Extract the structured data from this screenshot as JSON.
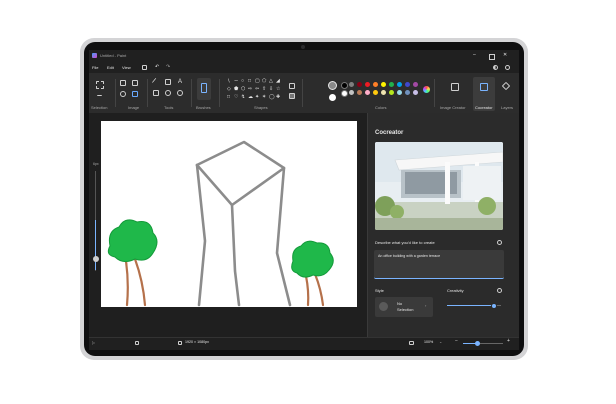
{
  "app": {
    "title": "Untitled - Paint"
  },
  "menu": {
    "file": "File",
    "edit": "Edit",
    "view": "View"
  },
  "ribbon": {
    "groups": {
      "selection": "Selection",
      "image": "Image",
      "tools": "Tools",
      "brushes": "Brushes",
      "shapes": "Shapes",
      "colors": "Colors",
      "image_creator": "Image Creator",
      "cocreator": "Cocreator",
      "layers": "Layers"
    },
    "palette": [
      "#000000",
      "#7f7f7f",
      "#880015",
      "#ed1c24",
      "#ff7f27",
      "#fff200",
      "#22b14c",
      "#00a2e8",
      "#3f48cc",
      "#a349a4",
      "#ffffff",
      "#c3c3c3",
      "#b97a57",
      "#ffaec9",
      "#ffc90e",
      "#efe4b0",
      "#b5e61d",
      "#99d9ea",
      "#7092be",
      "#c8bfe7"
    ]
  },
  "sidebar": {
    "brush_size_label": "6px",
    "brush_size_level": 0.45
  },
  "cocreator": {
    "title": "Cocreator",
    "describe_label": "Describe what you'd like to create",
    "prompt_value": "An office building with a garden terrace",
    "style_label": "Style",
    "style_value_line1": "No",
    "style_value_line2": "Selection",
    "creativity_label": "Creativity",
    "creativity_level": 0.85
  },
  "status": {
    "canvas_size": "1920 × 1080px",
    "zoom": "100%",
    "zoom_level": 0.35
  },
  "colors": {
    "accent": "#7ab4ff",
    "tree_green": "#1fb84a",
    "trunk_brown": "#b5714b"
  }
}
